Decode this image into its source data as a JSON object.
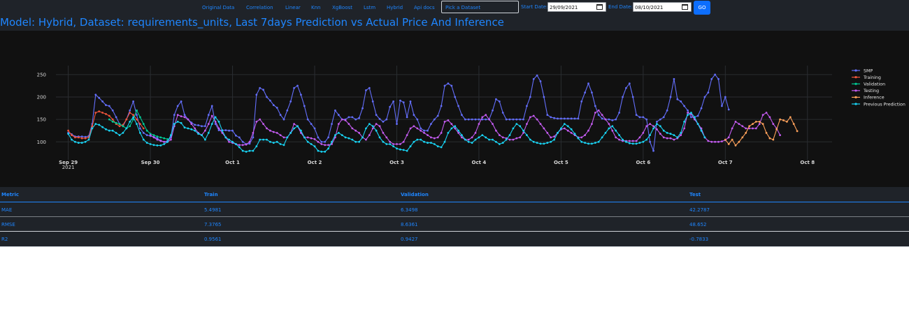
{
  "nav": {
    "links": [
      "Original Data",
      "Correlation",
      "Linear",
      "Knn",
      "XgBoost",
      "Lstm",
      "Hybrid",
      "Api docs"
    ],
    "dataset_select": "Pick a Dataset",
    "start_label": "Start Date:",
    "start_value": "29/09/2021",
    "end_label": "End Date:",
    "end_value": "08/10/2021",
    "go_label": "GO"
  },
  "page_title": "Model: Hybrid, Dataset: requirements_units, Last 7days Prediction vs Actual Price And Inference",
  "chart_data": {
    "type": "line",
    "title": "",
    "xlabel": "",
    "ylabel": "",
    "x_ticks": [
      {
        "label": "Sep 29",
        "sub": "2021",
        "day": 0
      },
      {
        "label": "Sep 30",
        "sub": "",
        "day": 1
      },
      {
        "label": "Oct 1",
        "sub": "",
        "day": 2
      },
      {
        "label": "Oct 2",
        "sub": "",
        "day": 3
      },
      {
        "label": "Oct 3",
        "sub": "",
        "day": 4
      },
      {
        "label": "Oct 4",
        "sub": "",
        "day": 5
      },
      {
        "label": "Oct 5",
        "sub": "",
        "day": 6
      },
      {
        "label": "Oct 6",
        "sub": "",
        "day": 7
      },
      {
        "label": "Oct 7",
        "sub": "",
        "day": 8
      },
      {
        "label": "Oct 8",
        "sub": "",
        "day": 9
      }
    ],
    "y_ticks": [
      100,
      150,
      200,
      250
    ],
    "ylim": [
      60,
      270
    ],
    "xlim_days": [
      -0.15,
      9.3
    ],
    "grid": true,
    "legend_position": "right",
    "series": [
      {
        "name": "SMP",
        "color": "#636efa",
        "start_day": 0,
        "step_hours": 1,
        "values": [
          120,
          117,
          112,
          112,
          112,
          111,
          113,
          140,
          205,
          198,
          190,
          182,
          180,
          170,
          155,
          140,
          135,
          150,
          170,
          190,
          160,
          130,
          120,
          115,
          113,
          111,
          108,
          103,
          100,
          102,
          110,
          160,
          180,
          190,
          160,
          150,
          143,
          138,
          137,
          135,
          135,
          160,
          180,
          140,
          126,
          126,
          126,
          125,
          125,
          114,
          110,
          100,
          95,
          96,
          110,
          205,
          220,
          216,
          200,
          192,
          182,
          176,
          160,
          150,
          170,
          190,
          220,
          225,
          205,
          180,
          150,
          140,
          130,
          110,
          100,
          100,
          110,
          140,
          170,
          160,
          150,
          150,
          155,
          155,
          150,
          153,
          175,
          215,
          220,
          190,
          160,
          151,
          145,
          150,
          178,
          190,
          140,
          192,
          188,
          155,
          190,
          160,
          150,
          130,
          125,
          125,
          140,
          150,
          158,
          180,
          225,
          230,
          225,
          200,
          180,
          160,
          150,
          150,
          150,
          150,
          150,
          150,
          150,
          150,
          170,
          195,
          190,
          165,
          150,
          150,
          150,
          150,
          150,
          150,
          180,
          200,
          240,
          248,
          235,
          200,
          160,
          155,
          153,
          152,
          152,
          152,
          152,
          152,
          152,
          152,
          190,
          210,
          230,
          210,
          180,
          160,
          152,
          150,
          150,
          148,
          150,
          165,
          200,
          220,
          230,
          200,
          160,
          155,
          155,
          150,
          100,
          80,
          145,
          150,
          155,
          170,
          200,
          240,
          195,
          190,
          180,
          170,
          155,
          155,
          158,
          175,
          200,
          210,
          240,
          250,
          240,
          180,
          200,
          172
        ]
      },
      {
        "name": "Training",
        "color": "#ef553b",
        "start_day": 0,
        "step_hours": 1,
        "values": [
          125,
          115,
          110,
          110,
          108,
          108,
          110,
          135,
          165,
          168,
          165,
          162,
          158,
          150,
          140,
          135,
          138,
          150,
          165,
          160,
          150,
          140,
          130,
          null
        ]
      },
      {
        "name": "Validation",
        "color": "#00cc96",
        "start_day": 0.5,
        "step_hours": 1,
        "values": [
          150,
          145,
          142,
          140,
          135,
          130,
          135,
          150,
          170,
          155,
          140,
          125,
          118,
          115,
          112,
          110,
          108,
          106
        ]
      },
      {
        "name": "Testing",
        "color": "#c35bf0",
        "start_day": 1.0,
        "step_hours": 1,
        "values": [
          115,
          110,
          105,
          102,
          100,
          100,
          105,
          135,
          160,
          157,
          155,
          150,
          140,
          130,
          120,
          115,
          125,
          140,
          158,
          145,
          130,
          120,
          110,
          100,
          98,
          95,
          93,
          93,
          94,
          100,
          120,
          145,
          150,
          140,
          130,
          125,
          122,
          120,
          115,
          110,
          110,
          120,
          140,
          135,
          120,
          110,
          110,
          108,
          106,
          100,
          95,
          93,
          93,
          95,
          110,
          140,
          150,
          148,
          140,
          130,
          125,
          120,
          110,
          105,
          115,
          130,
          140,
          135,
          120,
          110,
          100,
          95,
          95,
          95,
          100,
          115,
          130,
          135,
          130,
          125,
          120,
          115,
          110,
          108,
          110,
          120,
          145,
          148,
          140,
          130,
          120,
          110,
          105,
          105,
          110,
          120,
          140,
          155,
          160,
          150,
          140,
          125,
          115,
          110,
          108,
          105,
          105,
          108,
          110,
          120,
          140,
          155,
          158,
          150,
          140,
          130,
          120,
          110,
          112,
          120,
          128,
          130,
          125,
          120,
          115,
          110,
          110,
          115,
          125,
          140,
          165,
          170,
          160,
          150,
          140,
          125,
          110,
          105,
          102,
          102,
          102,
          102,
          102,
          110,
          120,
          135,
          140,
          135,
          128,
          118,
          110,
          108,
          108,
          105,
          108,
          115,
          130,
          165,
          162,
          150,
          140,
          130,
          110,
          102,
          100,
          100,
          100,
          101,
          104,
          110,
          130,
          145,
          140,
          135,
          130,
          130,
          130,
          130,
          140,
          160,
          165,
          155,
          140,
          130,
          115
        ]
      },
      {
        "name": "Inference",
        "color": "#ffa15a",
        "start_day": 8.0,
        "step_hours": 1,
        "values": [
          105,
          95,
          105,
          92,
          100,
          110,
          120,
          135,
          140,
          145,
          145,
          140,
          120,
          108,
          105,
          128,
          150,
          148,
          145,
          155,
          140,
          124
        ]
      },
      {
        "name": "Previous Prediction",
        "color": "#19d3f3",
        "start_day": 0,
        "step_hours": 1,
        "values": [
          118,
          105,
          100,
          98,
          98,
          100,
          105,
          130,
          140,
          138,
          133,
          128,
          125,
          125,
          120,
          115,
          120,
          130,
          145,
          155,
          140,
          120,
          105,
          98,
          95,
          93,
          92,
          92,
          95,
          100,
          115,
          140,
          145,
          142,
          132,
          130,
          128,
          125,
          118,
          115,
          105,
          120,
          140,
          155,
          145,
          125,
          110,
          105,
          100,
          95,
          88,
          80,
          78,
          80,
          80,
          90,
          105,
          105,
          105,
          100,
          98,
          100,
          95,
          93,
          110,
          120,
          130,
          135,
          125,
          110,
          100,
          95,
          90,
          80,
          78,
          78,
          85,
          100,
          115,
          120,
          115,
          110,
          108,
          105,
          100,
          100,
          110,
          130,
          140,
          135,
          125,
          110,
          100,
          95,
          95,
          90,
          85,
          83,
          82,
          80,
          90,
          100,
          105,
          105,
          100,
          98,
          98,
          95,
          90,
          88,
          100,
          120,
          130,
          135,
          125,
          115,
          105,
          100,
          98,
          105,
          110,
          115,
          110,
          105,
          105,
          100,
          95,
          98,
          105,
          115,
          130,
          140,
          135,
          125,
          115,
          105,
          100,
          98,
          96,
          96,
          98,
          100,
          105,
          120,
          130,
          140,
          135,
          128,
          118,
          108,
          100,
          98,
          96,
          96,
          98,
          100,
          110,
          120,
          130,
          135,
          125,
          115,
          105,
          100,
          97,
          96,
          96,
          98,
          100,
          105,
          115,
          130,
          140,
          135,
          125,
          120,
          118,
          115,
          110,
          120,
          145,
          160,
          165,
          155,
          140,
          125,
          110
        ]
      }
    ]
  },
  "metrics": {
    "headers": [
      "Metric",
      "Train",
      "Validation",
      "Test"
    ],
    "rows": [
      [
        "MAE",
        "5.4981",
        "6.3498",
        "42.2787"
      ],
      [
        "RMSE",
        "7.3765",
        "8.6361",
        "48.652"
      ],
      [
        "R2",
        "0.9561",
        "0.9427",
        "-0.7833"
      ]
    ]
  }
}
